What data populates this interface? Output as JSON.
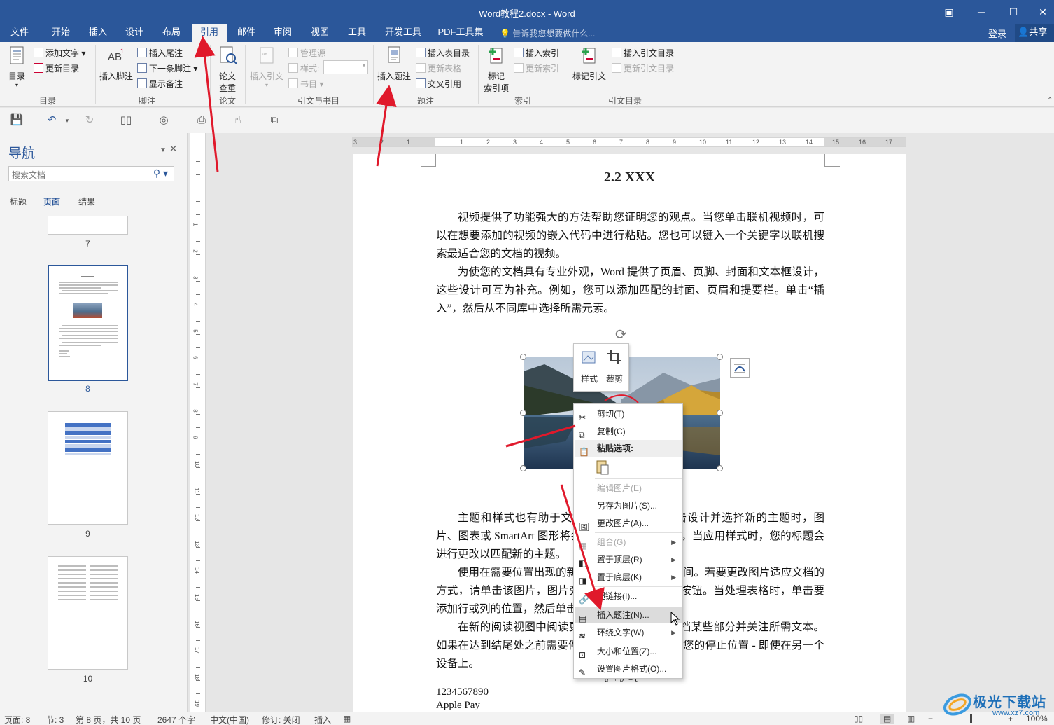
{
  "app": {
    "title": "Word教程2.docx - Word",
    "colors": {
      "accent": "#2b579a",
      "ribbon_bg": "#f3f3f3",
      "annotation_red": "#e0192b"
    }
  },
  "menu": {
    "tabs": [
      "文件",
      "开始",
      "插入",
      "设计",
      "布局",
      "引用",
      "邮件",
      "审阅",
      "视图",
      "工具",
      "开发工具",
      "PDF工具集"
    ],
    "active_tab": "引用",
    "tell_me": "告诉我您想要做什么...",
    "login": "登录",
    "share": "共享"
  },
  "ribbon": {
    "toc": {
      "big": "目录",
      "add_text": "添加文字",
      "update": "更新目录",
      "group": "目录"
    },
    "footnotes": {
      "big": "插入脚注",
      "endnote": "插入尾注",
      "next": "下一条脚注",
      "show": "显示备注",
      "group": "脚注"
    },
    "paper": {
      "big_line1": "论文",
      "big_line2": "查重",
      "group": "论文"
    },
    "citations": {
      "big": "插入引文",
      "manage": "管理源",
      "style": "样式:",
      "bib": "书目",
      "group": "引文与书目"
    },
    "captions": {
      "big": "插入题注",
      "tof": "插入表目录",
      "update_table": "更新表格",
      "cross_ref": "交叉引用",
      "group": "题注"
    },
    "index": {
      "big_line1": "标记",
      "big_line2": "索引项",
      "insert": "插入索引",
      "update": "更新索引",
      "group": "索引"
    },
    "toa": {
      "big": "标记引文",
      "insert": "插入引文目录",
      "update": "更新引文目录",
      "group": "引文目录"
    }
  },
  "nav": {
    "title": "导航",
    "search_placeholder": "搜索文档",
    "tabs": [
      "标题",
      "页面",
      "结果"
    ],
    "active_tab": "页面",
    "pages": [
      "7",
      "8",
      "9",
      "10"
    ],
    "selected_page": "8"
  },
  "document": {
    "heading": "2.2 XXX",
    "paragraphs": [
      "视频提供了功能强大的方法帮助您证明您的观点。当您单击联机视频时，可以在想要添加的视频的嵌入代码中进行粘贴。您也可以键入一个关键字以联机搜索最适合您的文档的视频。",
      "为使您的文档具有专业外观，Word 提供了页眉、页脚、封面和文本框设计，这些设计可互为补充。例如，您可以添加匹配的封面、页眉和提要栏。单击“插入”，然后从不同库中选择所需元素。",
      "主题和样式也有助于文档保持协调。当您单击设计并选择新的主题时，图片、图表或 SmartArt 图形将会更改以匹配新的主题。当应用样式时，您的标题会进行更改以匹配新的主题。",
      "使用在需要位置出现的新按钮在 Word 中节省时间。若要更改图片适应文档的方式，请单击该图片，图片旁边将会显示布局选项按钮。当处理表格时，单击要添加行或列的位置，然后单击加号。",
      "在新的阅读视图中阅读更加容易。可以折叠文档某些部分并关注所需文本。如果在达到结尾处之前需要停止读取，Word 会记住您的停止位置 - 即使在另一个设备上。"
    ],
    "formula": "a² + b² = c²",
    "number_line": "1234567890",
    "apple_line": "Apple Pay"
  },
  "mini_toolbar": {
    "style": "样式",
    "crop": "裁剪"
  },
  "context_menu": [
    {
      "label": "剪切(T)",
      "state": "normal",
      "icon": "scissors-icon"
    },
    {
      "label": "复制(C)",
      "state": "normal",
      "icon": "copy-icon"
    },
    {
      "label": "粘贴选项:",
      "state": "header",
      "icon": "paste-icon"
    },
    {
      "label": "编辑图片(E)",
      "state": "disabled",
      "icon": "none"
    },
    {
      "label": "另存为图片(S)...",
      "state": "normal",
      "icon": "none"
    },
    {
      "label": "更改图片(A)...",
      "state": "normal",
      "icon": "change-picture-icon"
    },
    {
      "label": "组合(G)",
      "state": "disabled",
      "icon": "group-icon"
    },
    {
      "label": "置于顶层(R)",
      "state": "normal",
      "icon": "bring-front-icon"
    },
    {
      "label": "置于底层(K)",
      "state": "normal",
      "icon": "send-back-icon"
    },
    {
      "label": "超链接(I)...",
      "state": "normal",
      "icon": "hyperlink-icon"
    },
    {
      "label": "插入题注(N)...",
      "state": "highlighted",
      "icon": "caption-icon"
    },
    {
      "label": "环绕文字(W)",
      "state": "normal",
      "icon": "wrap-text-icon"
    },
    {
      "label": "大小和位置(Z)...",
      "state": "normal",
      "icon": "size-icon"
    },
    {
      "label": "设置图片格式(O)...",
      "state": "normal",
      "icon": "format-picture-icon"
    }
  ],
  "status": {
    "page": "页面: 8",
    "section": "节: 3",
    "page_of": "第 8 页，共 10 页",
    "words": "2647 个字",
    "lang": "中文(中国)",
    "revisions": "修订: 关闭",
    "insert_mode": "插入",
    "zoom": "100%"
  },
  "watermark": {
    "text": "极光下载站",
    "url": "www.xz7.com"
  }
}
